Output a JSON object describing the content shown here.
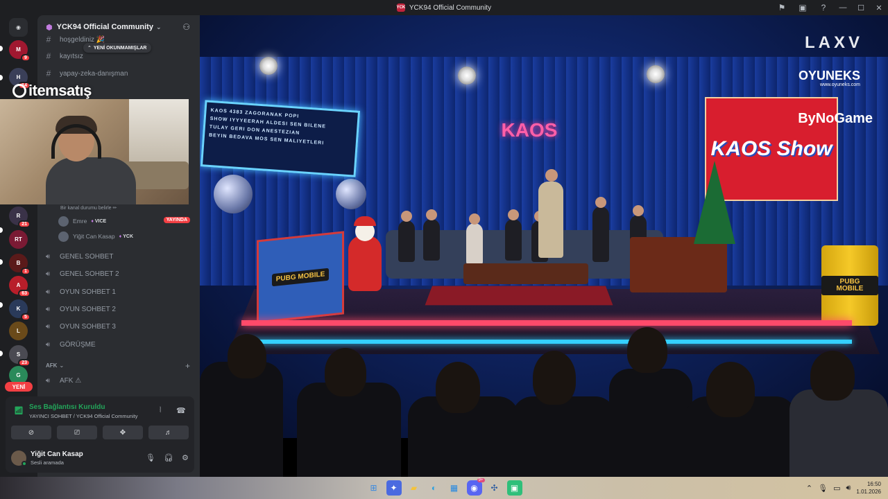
{
  "window": {
    "title": "YCK94 Official Community"
  },
  "server": {
    "name": "YCK94 Official Community",
    "unread_banner": "YENİ OKUNMAMIŞLAR"
  },
  "rail": {
    "badges": [
      "9",
      "14",
      "21",
      "1",
      "63",
      "5",
      "23"
    ],
    "new_pill": "YENİ"
  },
  "overlay": {
    "watermark": "itemsatış"
  },
  "text_channels": [
    {
      "name": "hoşgeldiniz 🎉"
    },
    {
      "name": "kayıtsız"
    },
    {
      "name": "yapay-zeka-danışman"
    }
  ],
  "voice_room": {
    "status_text": "Bir kanal durumu belirle ✏",
    "users": [
      {
        "name": "Emre",
        "tag": "VICE",
        "live": "YAYINDA"
      },
      {
        "name": "Yiğit Can Kasap",
        "tag": "YCK"
      }
    ]
  },
  "voice_channels": [
    {
      "name": "GENEL SOHBET"
    },
    {
      "name": "GENEL SOHBET 2"
    },
    {
      "name": "OYUN SOHBET 1"
    },
    {
      "name": "OYUN SOHBET 2"
    },
    {
      "name": "OYUN SOHBET 3"
    },
    {
      "name": "GÖRÜŞME"
    }
  ],
  "afk": {
    "category": "AFK",
    "channel": "AFK ⚠"
  },
  "voice_connection": {
    "status": "Ses Bağlantısı Kuruldu",
    "detail": "YAYINCI SOHBET / YCK94 Official Community"
  },
  "user_panel": {
    "name": "Yiğit Can Kasap",
    "status": "Sesli aramada"
  },
  "stream": {
    "sign_lines": [
      "KAOS  4383   ZAGORANAK  POPI",
      "SHOW  IYYYEERAH  ALDESI  SEN BILENE",
      "     TULAY GERI DON  ANESTEZIAN",
      "     BEYIN BEDAVA  MOS  SEN MALIYETLERI"
    ],
    "kaos_logo": "KAOS",
    "poster_text": "KAOS Show",
    "pubg_crate": "PUBG MOBILE",
    "pubg_barrel": "PUBG MOBILE",
    "sponsor_laxv": "LAXV",
    "sponsor_oyuneks": "OYUNEKS",
    "sponsor_oyuneks_url": "www.oyuneks.com",
    "sponsor_bynogame": "ByNoGame"
  },
  "taskbar": {
    "time": "16:50",
    "date": "1.01.2026",
    "discord_badge": "9+"
  },
  "colors": {
    "online_green": "#23a55a",
    "danger_red": "#f23f43",
    "sidebar_bg": "#2b2d31",
    "rail_bg": "#1e1f22"
  }
}
